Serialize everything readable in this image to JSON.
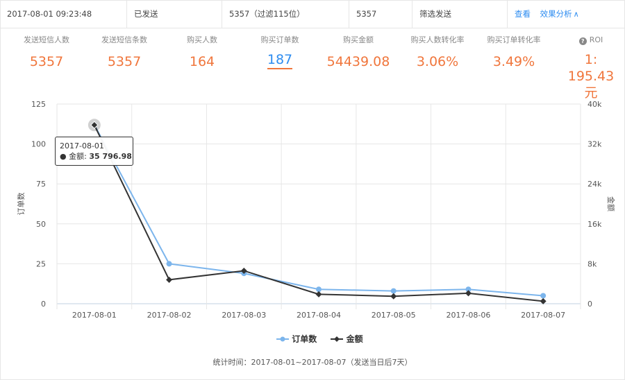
{
  "info": {
    "send_time": "2017-08-01 09:23:48",
    "status": "已发送",
    "recipients": "5357（过滤115位）",
    "sent_count": "5357",
    "mode": "筛选发送",
    "view_link": "查看",
    "analysis_link": "效果分析",
    "analysis_chevron": "∧"
  },
  "metrics": [
    {
      "label": "发送短信人数",
      "value": "5357"
    },
    {
      "label": "发送短信条数",
      "value": "5357"
    },
    {
      "label": "购买人数",
      "value": "164"
    },
    {
      "label": "购买订单数",
      "value": "187"
    },
    {
      "label": "购买金额",
      "value": "54439.08"
    },
    {
      "label": "购买人数转化率",
      "value": "3.06%"
    },
    {
      "label": "购买订单转化率",
      "value": "3.49%"
    },
    {
      "label": "ROI",
      "value": "1: 195.43元"
    }
  ],
  "tooltip": {
    "date": "2017-08-01",
    "series_name": "金额",
    "value_text": "35 796.98"
  },
  "footer": "统计时间：2017-08-01~2017-08-07（发送当日后7天）",
  "colors": {
    "orders": "#7cb5ec",
    "amount": "#333333",
    "metric_value": "#f0763c",
    "link": "#2d8cf0"
  },
  "chart_data": {
    "type": "line",
    "categories": [
      "2017-08-01",
      "2017-08-02",
      "2017-08-03",
      "2017-08-04",
      "2017-08-05",
      "2017-08-06",
      "2017-08-07"
    ],
    "series": [
      {
        "name": "订单数",
        "axis": "left",
        "values": [
          112,
          25,
          19,
          9,
          8,
          9,
          5
        ]
      },
      {
        "name": "金额",
        "axis": "right",
        "values": [
          35796.98,
          4800,
          6600,
          1900,
          1500,
          2100,
          500
        ]
      }
    ],
    "ylabel": "订单数",
    "ylabel_right": "金额",
    "ylim": [
      0,
      125
    ],
    "ylim_right": [
      0,
      40000
    ],
    "yticks": [
      "0",
      "25",
      "50",
      "75",
      "100",
      "125"
    ],
    "yticks_right": [
      "0",
      "8k",
      "16k",
      "24k",
      "32k",
      "40k"
    ],
    "grid": true,
    "legend_position": "bottom-center"
  }
}
